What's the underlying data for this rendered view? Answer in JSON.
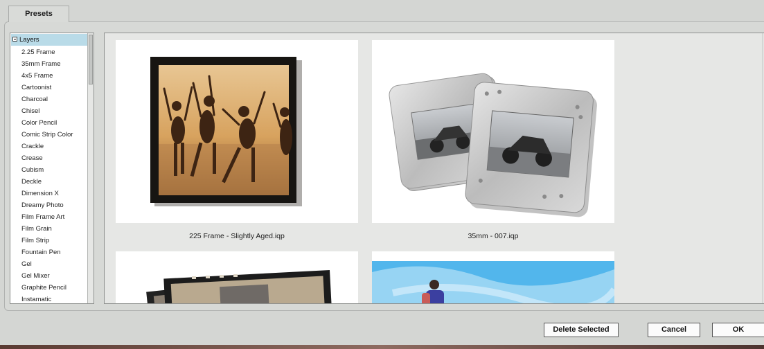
{
  "tabs": {
    "presets": "Presets"
  },
  "tree": {
    "root": "Layers",
    "items": [
      "2.25 Frame",
      "35mm Frame",
      "4x5 Frame",
      "Cartoonist",
      "Charcoal",
      "Chisel",
      "Color Pencil",
      "Comic Strip Color",
      "Crackle",
      "Crease",
      "Cubism",
      "Deckle",
      "Dimension X",
      "Dreamy Photo",
      "Film Frame Art",
      "Film Grain",
      "Film Strip",
      "Fountain Pen",
      "Gel",
      "Gel Mixer",
      "Graphite Pencil",
      "Instamatic"
    ]
  },
  "thumbnails": [
    {
      "caption": "225 Frame - Slightly Aged.iqp"
    },
    {
      "caption": "35mm - 007.iqp"
    }
  ],
  "buttons": {
    "delete_selected": "Delete Selected",
    "cancel": "Cancel",
    "ok": "OK"
  }
}
